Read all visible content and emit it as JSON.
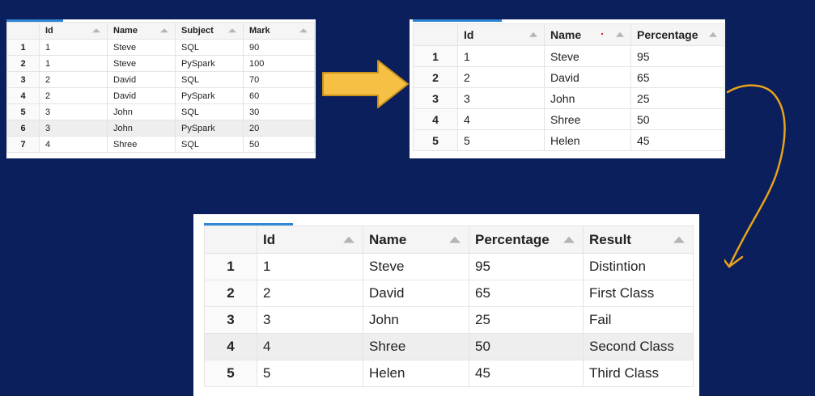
{
  "table1": {
    "columns": [
      "Id",
      "Name",
      "Subject",
      "Mark"
    ],
    "rows": [
      {
        "n": "1",
        "id": "1",
        "name": "Steve",
        "subject": "SQL",
        "mark": "90"
      },
      {
        "n": "2",
        "id": "1",
        "name": "Steve",
        "subject": "PySpark",
        "mark": "100"
      },
      {
        "n": "3",
        "id": "2",
        "name": "David",
        "subject": "SQL",
        "mark": "70"
      },
      {
        "n": "4",
        "id": "2",
        "name": "David",
        "subject": "PySpark",
        "mark": "60"
      },
      {
        "n": "5",
        "id": "3",
        "name": "John",
        "subject": "SQL",
        "mark": "30"
      },
      {
        "n": "6",
        "id": "3",
        "name": "John",
        "subject": "PySpark",
        "mark": "20"
      },
      {
        "n": "7",
        "id": "4",
        "name": "Shree",
        "subject": "SQL",
        "mark": "50"
      }
    ]
  },
  "table2": {
    "columns": [
      "Id",
      "Name",
      "Percentage"
    ],
    "rows": [
      {
        "n": "1",
        "id": "1",
        "name": "Steve",
        "pct": "95"
      },
      {
        "n": "2",
        "id": "2",
        "name": "David",
        "pct": "65"
      },
      {
        "n": "3",
        "id": "3",
        "name": "John",
        "pct": "25"
      },
      {
        "n": "4",
        "id": "4",
        "name": "Shree",
        "pct": "50"
      },
      {
        "n": "5",
        "id": "5",
        "name": "Helen",
        "pct": "45"
      }
    ]
  },
  "table3": {
    "columns": [
      "Id",
      "Name",
      "Percentage",
      "Result"
    ],
    "rows": [
      {
        "n": "1",
        "id": "1",
        "name": "Steve",
        "pct": "95",
        "result": "Distintion"
      },
      {
        "n": "2",
        "id": "2",
        "name": "David",
        "pct": "65",
        "result": "First Class"
      },
      {
        "n": "3",
        "id": "3",
        "name": "John",
        "pct": "25",
        "result": "Fail"
      },
      {
        "n": "4",
        "id": "4",
        "name": "Shree",
        "pct": "50",
        "result": "Second Class"
      },
      {
        "n": "5",
        "id": "5",
        "name": "Helen",
        "pct": "45",
        "result": "Third Class"
      }
    ]
  },
  "colors": {
    "background": "#0b1f5c",
    "arrow_fill": "#f5c044",
    "curve": "#e8a21c",
    "accent": "#2f86d3"
  }
}
